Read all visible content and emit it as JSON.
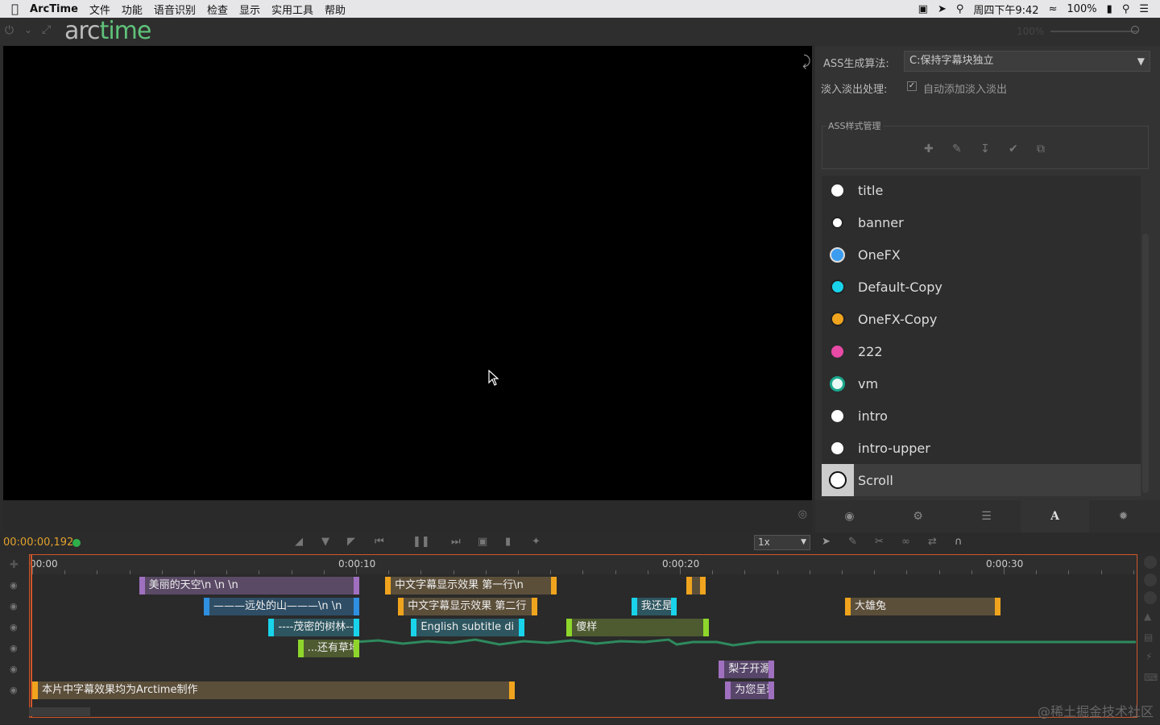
{
  "menubar": {
    "apple": "",
    "app_name": "ArcTime",
    "items": [
      "文件",
      "功能",
      "语音识别",
      "检查",
      "显示",
      "实用工具",
      "帮助"
    ],
    "status": {
      "clock": "周四下午9:42",
      "battery": "100%"
    }
  },
  "logo": {
    "part1": "arc",
    "part2": "time"
  },
  "zoom": {
    "value": "100%"
  },
  "panel": {
    "algo_label": "ASS生成算法:",
    "algo_value": "C:保持字幕块独立",
    "fade_label": "淡入淡出处理:",
    "fade_checkbox_label": "自动添加淡入淡出",
    "fade_checked": true,
    "style_group_label": "ASS样式管理",
    "styles": [
      {
        "name": "title",
        "color": "#ffffff"
      },
      {
        "name": "banner",
        "color": "#ffffff"
      },
      {
        "name": "OneFX",
        "color": "#3b9cf0"
      },
      {
        "name": "Default-Copy",
        "color": "#19d3ea"
      },
      {
        "name": "OneFX-Copy",
        "color": "#f0a41e"
      },
      {
        "name": "222",
        "color": "#e94aa6"
      },
      {
        "name": "vm",
        "color": "#e8f8f4"
      },
      {
        "name": "intro",
        "color": "#ffffff"
      },
      {
        "name": "intro-upper",
        "color": "#ffffff"
      },
      {
        "name": "Scroll",
        "color": "#ffffff"
      }
    ],
    "selected_style": "Scroll"
  },
  "transport": {
    "timecode": "00:00:00,192",
    "speed": "1x"
  },
  "timeline": {
    "ruler_labels": [
      "00:00",
      "0:00:10",
      "0:00:20",
      "0:00:30"
    ],
    "tracks": [
      {
        "clips": [
          {
            "text": "美丽的天空\\n \\n \\n",
            "color": "#5a4a66",
            "edge": "#a070c0",
            "from": 3.3,
            "to": 10.1
          },
          {
            "text": "中文字幕显示效果 第一行\\n",
            "color": "#5c4f3a",
            "edge": "#f0a41e",
            "from": 10.9,
            "to": 16.2
          },
          {
            "text": "",
            "color": "#5c4f3a",
            "edge": "#f0a41e",
            "from": 20.2,
            "to": 20.8
          }
        ]
      },
      {
        "clips": [
          {
            "text": "———远处的山———\\n \\n",
            "color": "#2f4e66",
            "edge": "#2f8fe0",
            "from": 5.3,
            "to": 10.1
          },
          {
            "text": "中文字幕显示效果 第二行",
            "color": "#5c4f3a",
            "edge": "#f0a41e",
            "from": 11.3,
            "to": 15.6
          },
          {
            "text": "我还是",
            "color": "#2e5660",
            "edge": "#19d3ea",
            "from": 18.5,
            "to": 19.9
          },
          {
            "text": "大雄兔",
            "color": "#5c4f3a",
            "edge": "#f0a41e",
            "from": 25.1,
            "to": 29.9
          }
        ]
      },
      {
        "clips": [
          {
            "text": "----茂密的树林----\\n",
            "color": "#2e5660",
            "edge": "#19d3ea",
            "from": 7.3,
            "to": 10.1
          },
          {
            "text": "English subtitle di",
            "color": "#2e5660",
            "edge": "#19d3ea",
            "from": 11.7,
            "to": 15.2
          },
          {
            "text": "傻样",
            "color": "#4e5a30",
            "edge": "#8ed62b",
            "from": 16.5,
            "to": 20.9
          }
        ]
      },
      {
        "clips": [
          {
            "text": "...还有草地",
            "color": "#4e5a30",
            "edge": "#8ed62b",
            "from": 8.2,
            "to": 10.1
          }
        ]
      },
      {
        "clips": [
          {
            "text": "梨子开源",
            "color": "#57456a",
            "edge": "#a070c0",
            "from": 21.2,
            "to": 22.9
          }
        ]
      },
      {
        "clips": [
          {
            "text": "本片中字幕效果均为Arctime制作",
            "color": "#5c4f3a",
            "edge": "#f0a41e",
            "from": 0.0,
            "to": 14.9
          },
          {
            "text": "为您呈现",
            "color": "#57456a",
            "edge": "#a070c0",
            "from": 21.4,
            "to": 22.9
          }
        ]
      }
    ]
  },
  "watermark": "@稀土掘金技术社区"
}
